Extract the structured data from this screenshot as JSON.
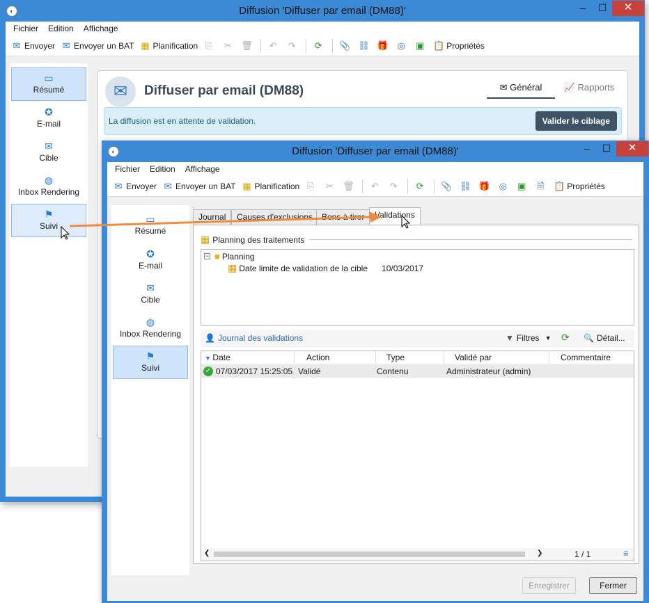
{
  "back_window": {
    "title": "Diffusion 'Diffuser par email (DM88)'",
    "menu": [
      "Fichier",
      "Edition",
      "Affichage"
    ],
    "toolbar": {
      "send": "Envoyer",
      "send_proof": "Envoyer un BAT",
      "schedule": "Planification",
      "properties": "Propriétés"
    },
    "nav": [
      "Résumé",
      "E-mail",
      "Cible",
      "Inbox Rendering",
      "Suivi"
    ],
    "header_title": "Diffuser par email (DM88)",
    "header_tabs": [
      "Général",
      "Rapports"
    ],
    "banner_text": "La diffusion est en attente de validation.",
    "banner_button": "Valider le ciblage"
  },
  "front_window": {
    "title": "Diffusion 'Diffuser par email (DM88)'",
    "menu": [
      "Fichier",
      "Edition",
      "Affichage"
    ],
    "toolbar": {
      "send": "Envoyer",
      "send_proof": "Envoyer un BAT",
      "schedule": "Planification",
      "properties": "Propriétés"
    },
    "nav": [
      "Résumé",
      "E-mail",
      "Cible",
      "Inbox Rendering",
      "Suivi"
    ],
    "tabs": [
      "Journal",
      "Causes d'exclusions",
      "Bons à tirer",
      "Validations"
    ],
    "planning_title": "Planning des traitements",
    "tree": {
      "root": "Planning",
      "child_label": "Date limite de validation de la cible",
      "child_date": "10/03/2017"
    },
    "journal_title": "Journal des validations",
    "filters": "Filtres",
    "detail": "Détail...",
    "columns": [
      "Date",
      "Action",
      "Type",
      "Validé par",
      "Commentaire"
    ],
    "rows": [
      {
        "date": "07/03/2017 15:25:05",
        "action": "Validé",
        "type": "Contenu",
        "by": "Administrateur (admin)",
        "comment": ""
      }
    ],
    "pager": "1 / 1",
    "save": "Enregistrer",
    "close": "Fermer"
  },
  "colors": {
    "titlebar": "#3c8ad6",
    "close": "#c7423a",
    "accent": "#2a78c8",
    "banner_bg": "#d9eef7",
    "arrow": "#f08a3c"
  }
}
